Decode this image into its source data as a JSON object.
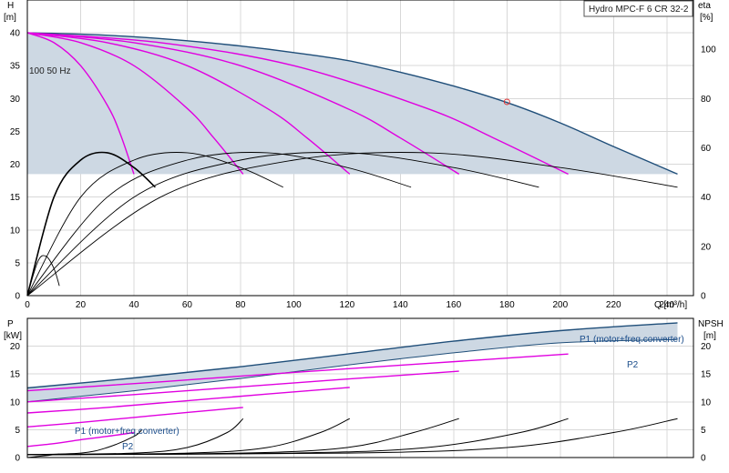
{
  "title": "Hydro MPC-F 6 CR 32-2",
  "colors": {
    "envelope_fill": "#cdd8e3",
    "envelope_stroke": "#1f4e79",
    "curve_magenta": "#e000e0",
    "curve_black": "#000000",
    "annotation_blue": "#1a4c8a"
  },
  "chart_data": [
    {
      "type": "line",
      "name": "head",
      "xlabel": "Q [m³/h]",
      "ylabel_left": "H",
      "ylabel_left_unit": "[m]",
      "ylabel_right": "eta",
      "ylabel_right_unit": "[%]",
      "xlim": [
        0,
        250
      ],
      "ylim": [
        0,
        45
      ],
      "ylim_right": [
        0,
        120
      ],
      "x_ticks": [
        0,
        20,
        40,
        60,
        80,
        100,
        120,
        140,
        160,
        180,
        200,
        220,
        240
      ],
      "y_ticks": [
        0,
        5,
        10,
        15,
        20,
        25,
        30,
        35,
        40
      ],
      "y_ticks_right": [
        0,
        20,
        40,
        60,
        80,
        100
      ],
      "grid": true,
      "annotation": "100 50 Hz",
      "duty_point": {
        "x": 180,
        "y": 29.5
      },
      "envelope": {
        "top": [
          [
            0,
            40
          ],
          [
            20,
            39.8
          ],
          [
            40,
            39.4
          ],
          [
            60,
            38.8
          ],
          [
            80,
            38
          ],
          [
            100,
            37
          ],
          [
            120,
            35.8
          ],
          [
            140,
            34
          ],
          [
            160,
            31.9
          ],
          [
            180,
            29.4
          ],
          [
            200,
            26.3
          ],
          [
            220,
            22.7
          ],
          [
            244,
            18.5
          ]
        ],
        "floor": 18.5
      },
      "head_curves": [
        [
          [
            0,
            40
          ],
          [
            10,
            38.5
          ],
          [
            20,
            35
          ],
          [
            30,
            29
          ],
          [
            35,
            24.5
          ],
          [
            40,
            18.5
          ]
        ],
        [
          [
            0,
            40
          ],
          [
            20,
            38.5
          ],
          [
            40,
            35
          ],
          [
            60,
            28.5
          ],
          [
            70,
            24
          ],
          [
            81,
            18.5
          ]
        ],
        [
          [
            0,
            40
          ],
          [
            30,
            38.5
          ],
          [
            60,
            35
          ],
          [
            90,
            28.5
          ],
          [
            105,
            24
          ],
          [
            121,
            18.5
          ]
        ],
        [
          [
            0,
            40
          ],
          [
            40,
            38.5
          ],
          [
            80,
            35
          ],
          [
            120,
            28.5
          ],
          [
            140,
            24
          ],
          [
            162,
            18.5
          ]
        ],
        [
          [
            0,
            40
          ],
          [
            50,
            38.5
          ],
          [
            100,
            35
          ],
          [
            150,
            28.5
          ],
          [
            175,
            24
          ],
          [
            203,
            18.5
          ]
        ]
      ],
      "efficiency_curves": [
        [
          [
            0,
            0
          ],
          [
            4,
            14
          ],
          [
            7,
            16
          ],
          [
            10,
            11
          ],
          [
            12,
            4
          ]
        ],
        [
          [
            0,
            0
          ],
          [
            10,
            40
          ],
          [
            20,
            55
          ],
          [
            30,
            58
          ],
          [
            40,
            52
          ],
          [
            48,
            44
          ]
        ],
        [
          [
            0,
            0
          ],
          [
            20,
            40
          ],
          [
            40,
            55
          ],
          [
            60,
            58
          ],
          [
            80,
            52
          ],
          [
            96,
            44
          ]
        ],
        [
          [
            0,
            0
          ],
          [
            30,
            40
          ],
          [
            60,
            55
          ],
          [
            90,
            58
          ],
          [
            120,
            52
          ],
          [
            144,
            44
          ]
        ],
        [
          [
            0,
            0
          ],
          [
            40,
            40
          ],
          [
            80,
            55
          ],
          [
            120,
            58
          ],
          [
            160,
            52
          ],
          [
            192,
            44
          ]
        ],
        [
          [
            0,
            0
          ],
          [
            50,
            40
          ],
          [
            100,
            55
          ],
          [
            150,
            58
          ],
          [
            200,
            52
          ],
          [
            244,
            44
          ]
        ]
      ]
    },
    {
      "type": "line",
      "name": "power",
      "xlabel": "",
      "ylabel_left": "P",
      "ylabel_left_unit": "[kW]",
      "ylabel_right": "NPSH",
      "ylabel_right_unit": "[m]",
      "xlim": [
        0,
        250
      ],
      "ylim": [
        0,
        25
      ],
      "x_ticks": [
        0,
        20,
        40,
        60,
        80,
        100,
        120,
        140,
        160,
        180,
        200,
        220,
        240
      ],
      "y_ticks": [
        0,
        5,
        10,
        15,
        20
      ],
      "grid": true,
      "labels": {
        "p1_right": "P1 (motor+freq.converter)",
        "p2_right": "P2",
        "p1_left": "P1 (motor+freq.converter)",
        "p2_left": "P2"
      },
      "p1_envelope": [
        [
          0,
          12.5
        ],
        [
          40,
          14.3
        ],
        [
          80,
          16.3
        ],
        [
          120,
          18.6
        ],
        [
          160,
          20.9
        ],
        [
          200,
          22.8
        ],
        [
          244,
          24.2
        ]
      ],
      "p2_envelope": [
        [
          0,
          10
        ],
        [
          40,
          12
        ],
        [
          80,
          14.2
        ],
        [
          120,
          16.6
        ],
        [
          160,
          18.8
        ],
        [
          200,
          20.6
        ],
        [
          244,
          21.2
        ]
      ],
      "power_curves": [
        [
          [
            0,
            2
          ],
          [
            10,
            2.5
          ],
          [
            20,
            3.2
          ],
          [
            30,
            3.8
          ],
          [
            40,
            4.5
          ]
        ],
        [
          [
            0,
            5.5
          ],
          [
            20,
            6.3
          ],
          [
            40,
            7.2
          ],
          [
            60,
            8.1
          ],
          [
            81,
            9
          ]
        ],
        [
          [
            0,
            8
          ],
          [
            30,
            9
          ],
          [
            60,
            10.2
          ],
          [
            90,
            11.4
          ],
          [
            121,
            12.6
          ]
        ],
        [
          [
            0,
            10
          ],
          [
            40,
            11.3
          ],
          [
            80,
            12.7
          ],
          [
            120,
            14.1
          ],
          [
            162,
            15.5
          ]
        ],
        [
          [
            0,
            12
          ],
          [
            50,
            13.6
          ],
          [
            100,
            15.3
          ],
          [
            150,
            16.9
          ],
          [
            203,
            18.6
          ]
        ]
      ],
      "npsh_curves": [
        [
          [
            0,
            0
          ],
          [
            4,
            0.2
          ],
          [
            8,
            0.4
          ],
          [
            12,
            0.6
          ]
        ],
        [
          [
            0,
            0.5
          ],
          [
            20,
            0.8
          ],
          [
            30,
            1.8
          ],
          [
            40,
            3.8
          ],
          [
            43,
            5
          ]
        ],
        [
          [
            0,
            0.5
          ],
          [
            40,
            0.8
          ],
          [
            60,
            1.8
          ],
          [
            75,
            4.5
          ],
          [
            81,
            7
          ]
        ],
        [
          [
            0,
            0.5
          ],
          [
            60,
            0.8
          ],
          [
            90,
            1.8
          ],
          [
            110,
            4.5
          ],
          [
            121,
            7
          ]
        ],
        [
          [
            0,
            0.5
          ],
          [
            80,
            0.8
          ],
          [
            120,
            1.8
          ],
          [
            145,
            4.5
          ],
          [
            162,
            7
          ]
        ],
        [
          [
            0,
            0.5
          ],
          [
            100,
            0.8
          ],
          [
            150,
            1.8
          ],
          [
            185,
            4.5
          ],
          [
            203,
            7
          ]
        ],
        [
          [
            0,
            0.5
          ],
          [
            120,
            0.8
          ],
          [
            180,
            1.8
          ],
          [
            220,
            4.5
          ],
          [
            244,
            7
          ]
        ]
      ]
    }
  ]
}
